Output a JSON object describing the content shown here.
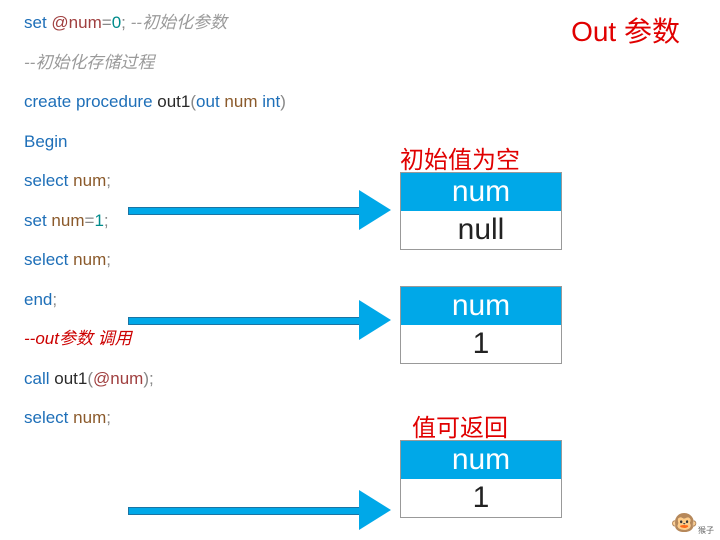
{
  "title": "Out 参数",
  "labels": {
    "initNull": "初始值为空",
    "returnable": "值可返回"
  },
  "code": {
    "l1_set": "set",
    "l1_at": "@num",
    "l1_eq": "=",
    "l1_zero": "0",
    "l1_semi": ";",
    "l1_comment": "--初始化参数",
    "l2_comment": "--初始化存储过程",
    "l3_create": "create procedure",
    "l3_name": "out1",
    "l3_lpar": "(",
    "l3_out": "out",
    "l3_param": "num",
    "l3_type": "int",
    "l3_rpar": ")",
    "l4_begin": "Begin",
    "l5_select": "select",
    "l5_num": "num",
    "l5_semi": ";",
    "l6_set": "set",
    "l6_num": "num",
    "l6_eq": "=",
    "l6_one": "1",
    "l6_semi": ";",
    "l7_select": "select",
    "l7_num": "num",
    "l7_semi": ";",
    "l8_end": "end",
    "l8_semi": ";",
    "l9_comment": "--out参数 调用",
    "l10_call": "call",
    "l10_name": "out1",
    "l10_lpar": "(",
    "l10_at": "@num",
    "l10_rpar": ")",
    "l10_semi": ";",
    "l11_select": "select",
    "l11_num": "num",
    "l11_semi": ";"
  },
  "boxes": {
    "b1_header": "num",
    "b1_value": "null",
    "b2_header": "num",
    "b2_value": "1",
    "b3_header": "num",
    "b3_value": "1"
  },
  "footer": "猴子"
}
